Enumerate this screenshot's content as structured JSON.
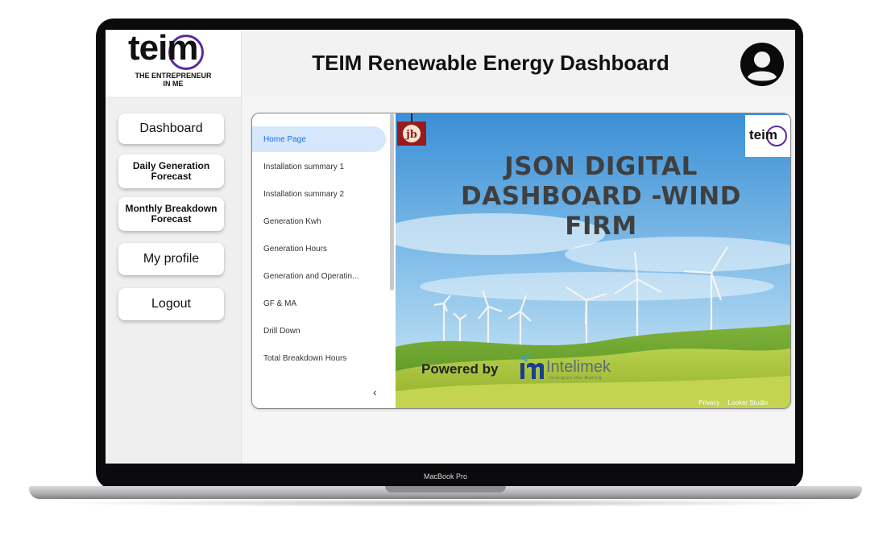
{
  "device_label": "MacBook Pro",
  "header": {
    "logo_word": "teim",
    "logo_subtitle_1": "THE ENTREPRENEUR",
    "logo_subtitle_2": "IN ME",
    "title": "TEIM Renewable Energy Dashboard",
    "avatar_icon": "user-circle-icon"
  },
  "sidebar": {
    "items": [
      {
        "label": "Dashboard"
      },
      {
        "label": "Daily Generation Forecast"
      },
      {
        "label": "Monthly Breakdown Forecast"
      },
      {
        "label": "My profile"
      },
      {
        "label": "Logout"
      }
    ]
  },
  "report": {
    "nav": {
      "items": [
        {
          "label": "Home Page",
          "active": true
        },
        {
          "label": "Installation summary 1"
        },
        {
          "label": "Installation summary 2"
        },
        {
          "label": "Generation Kwh"
        },
        {
          "label": "Generation Hours"
        },
        {
          "label": "Generation and Operatin..."
        },
        {
          "label": "GF & MA"
        },
        {
          "label": "Drill Down"
        },
        {
          "label": "Total Breakdown Hours"
        }
      ],
      "collapse_icon": "chevron-left-icon",
      "collapse_glyph": "‹"
    },
    "canvas": {
      "title_line_1": "JSON DIGITAL",
      "title_line_2": "DASHBOARD -WIND",
      "title_line_3": "FIRM",
      "corner_logo_text": "teim",
      "footer_privacy": "Privacy",
      "footer_looker": "Looker Studio"
    }
  },
  "footer": {
    "powered_by": "Powered by",
    "brand": "Intelimek",
    "brand_tagline": "Inteligize the Making"
  },
  "colors": {
    "active_nav_bg": "#d6e6fb",
    "active_nav_text": "#1a73e8",
    "logo_ring": "#5a2aa0",
    "brand": "#5a6b78"
  }
}
